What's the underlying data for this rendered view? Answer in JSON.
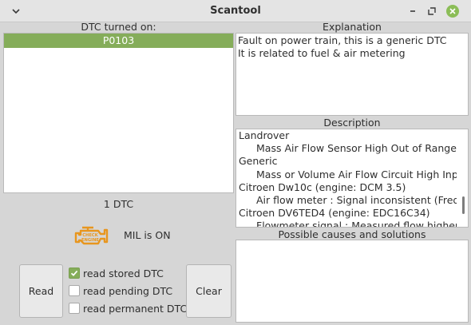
{
  "window": {
    "title": "Scantool"
  },
  "dtc_panel": {
    "header": "DTC turned on:",
    "items": [
      "P0103"
    ],
    "count_label": "1 DTC"
  },
  "explanation": {
    "header": "Explanation",
    "lines": [
      "Fault on power train, this is a generic DTC",
      "It is related to fuel & air metering"
    ]
  },
  "description": {
    "header": "Description",
    "lines": [
      "Landrover",
      "Mass Air Flow Sensor High Out of Range Fau",
      "Generic",
      "Mass or Volume Air Flow Circuit High Input",
      "Citroen Dw10c (engine: DCM 3.5)",
      "Air flow meter : Signal inconsistent (Frequenc",
      "Citroen DV6TED4 (engine: EDC16C34)",
      "Flowmeter signal : Measured flow higher tha"
    ]
  },
  "causes": {
    "header": "Possible causes and solutions"
  },
  "mil": {
    "label": "MIL is ON",
    "icon": "check-engine-icon",
    "icon_text": [
      "CHECK",
      "ENGINE"
    ],
    "color": "#e8961e"
  },
  "controls": {
    "read_label": "Read",
    "clear_label": "Clear",
    "options": [
      {
        "label": "read stored DTC",
        "checked": true
      },
      {
        "label": "read pending DTC",
        "checked": false
      },
      {
        "label": "read permanent DTC",
        "checked": false
      }
    ]
  },
  "colors": {
    "accent": "#85ad5a",
    "close": "#8bbd57"
  }
}
